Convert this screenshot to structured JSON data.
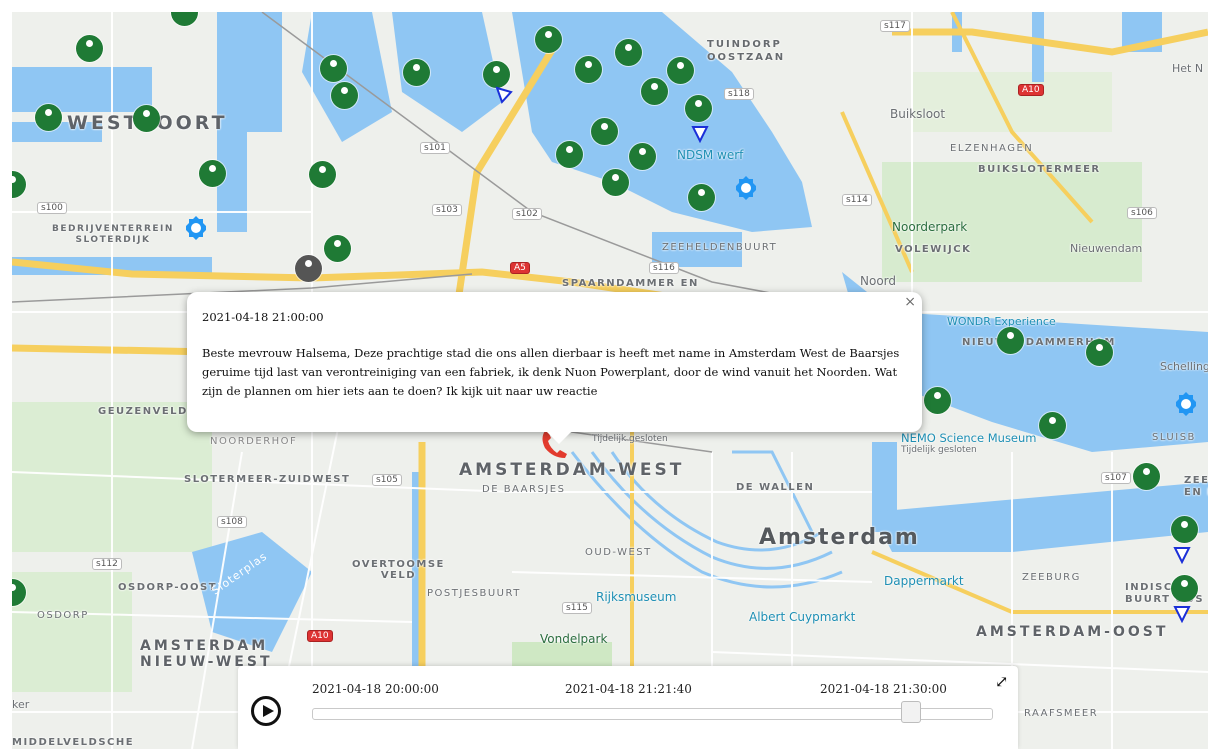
{
  "map_labels": {
    "westpoort": "WESTPOORT",
    "tuindorp": "TUINDORP\nOOSTZAAN",
    "buiksloot": "Buiksloot",
    "elzenhagen": "ELZENHAGEN",
    "buikslotermeer": "BUIKSLOTERMEER",
    "ndsm": "NDSM werf",
    "bedrijventerrein": "BEDRIJVENTERREIN\nSLOTERDIJK",
    "zeeheldenbuurt": "ZEEHELDENBUURT",
    "spaarndammer": "SPAARNDAMMER EN",
    "noorderpark": "Noorderpark",
    "volewijck": "VOLEWIJCK",
    "nieuwendam": "Nieuwendam",
    "noord": "Noord",
    "het_n": "Het N",
    "wondr": "WONDR Experience",
    "nieuwe": "NIEUWENDAMMERHAM",
    "schelling": "Schelling",
    "geuzenveld": "GEUZENVELD",
    "noorderhof": "NOORDERHOF",
    "nemo": "NEMO Science Museum",
    "nemo_sub": "Tijdelijk gesloten",
    "sluis": "SLUISB",
    "slotermeer": "SLOTERMEER-ZUIDWEST",
    "amsterdam_west": "AMSTERDAM-WEST",
    "de_baarsjes": "DE BAARSJES",
    "de_wallen": "DE WALLEN",
    "zeeburg_n": "ZEEBU\nEN N",
    "amsterdam": "Amsterdam",
    "oud_west": "OUD-WEST",
    "overtoomse": "OVERTOOMSE\nVELD",
    "osdorp_oost": "OSDORP-OOST",
    "osdorp": "OSDORP",
    "postjes": "POSTJESBUURT",
    "rijksmuseum": "Rijksmuseum",
    "dappermarkt": "Dappermarkt",
    "zeeburg": "ZEEBURG",
    "indische": "INDISCHE\nBUURT OOS",
    "albert": "Albert Cuypmarkt",
    "vondelpark": "Vondelpark",
    "nieuw_west": "AMSTERDAM\nNIEUW-WEST",
    "amsterdam_oost": "AMSTERDAM-OOST",
    "raafsmeer": "RAAFSMEER",
    "middelveldsche": "MIDDELVELDSCHE",
    "ker": "ker",
    "sloterplas": "Sloterplas",
    "tijdelijk": "Tijdelijk gesloten"
  },
  "road_shields": [
    "s117",
    "A10",
    "s118",
    "s101",
    "s102",
    "s100",
    "A5",
    "s103",
    "s116",
    "s114",
    "s106",
    "s107",
    "s105",
    "s108",
    "s112",
    "s115",
    "A10"
  ],
  "popup": {
    "timestamp": "2021-04-18 21:00:00",
    "message": "Beste mevrouw Halsema, Deze prachtige stad die ons allen dierbaar is heeft met name in Amsterdam West de Baarsjes geruime tijd last van verontreiniging van een fabriek, ik denk Nuon Powerplant, door de wind vanuit het Noorden. Wat zijn de plannen om hier iets aan te doen? Ik kijk uit naar uw reactie",
    "close": "×"
  },
  "timeline": {
    "start": "2021-04-18  20:00:00",
    "current": "2021-04-18  21:21:40",
    "end": "2021-04-18  21:30:00",
    "progress": 0.88,
    "expand_icon": "⤢"
  },
  "colors": {
    "marker": "#1f7a35",
    "water": "#8fc6f3",
    "road": "#f8d36b",
    "gear": "#2196f3",
    "triangle": "#1b2fd8",
    "phone": "#e23b2e"
  }
}
